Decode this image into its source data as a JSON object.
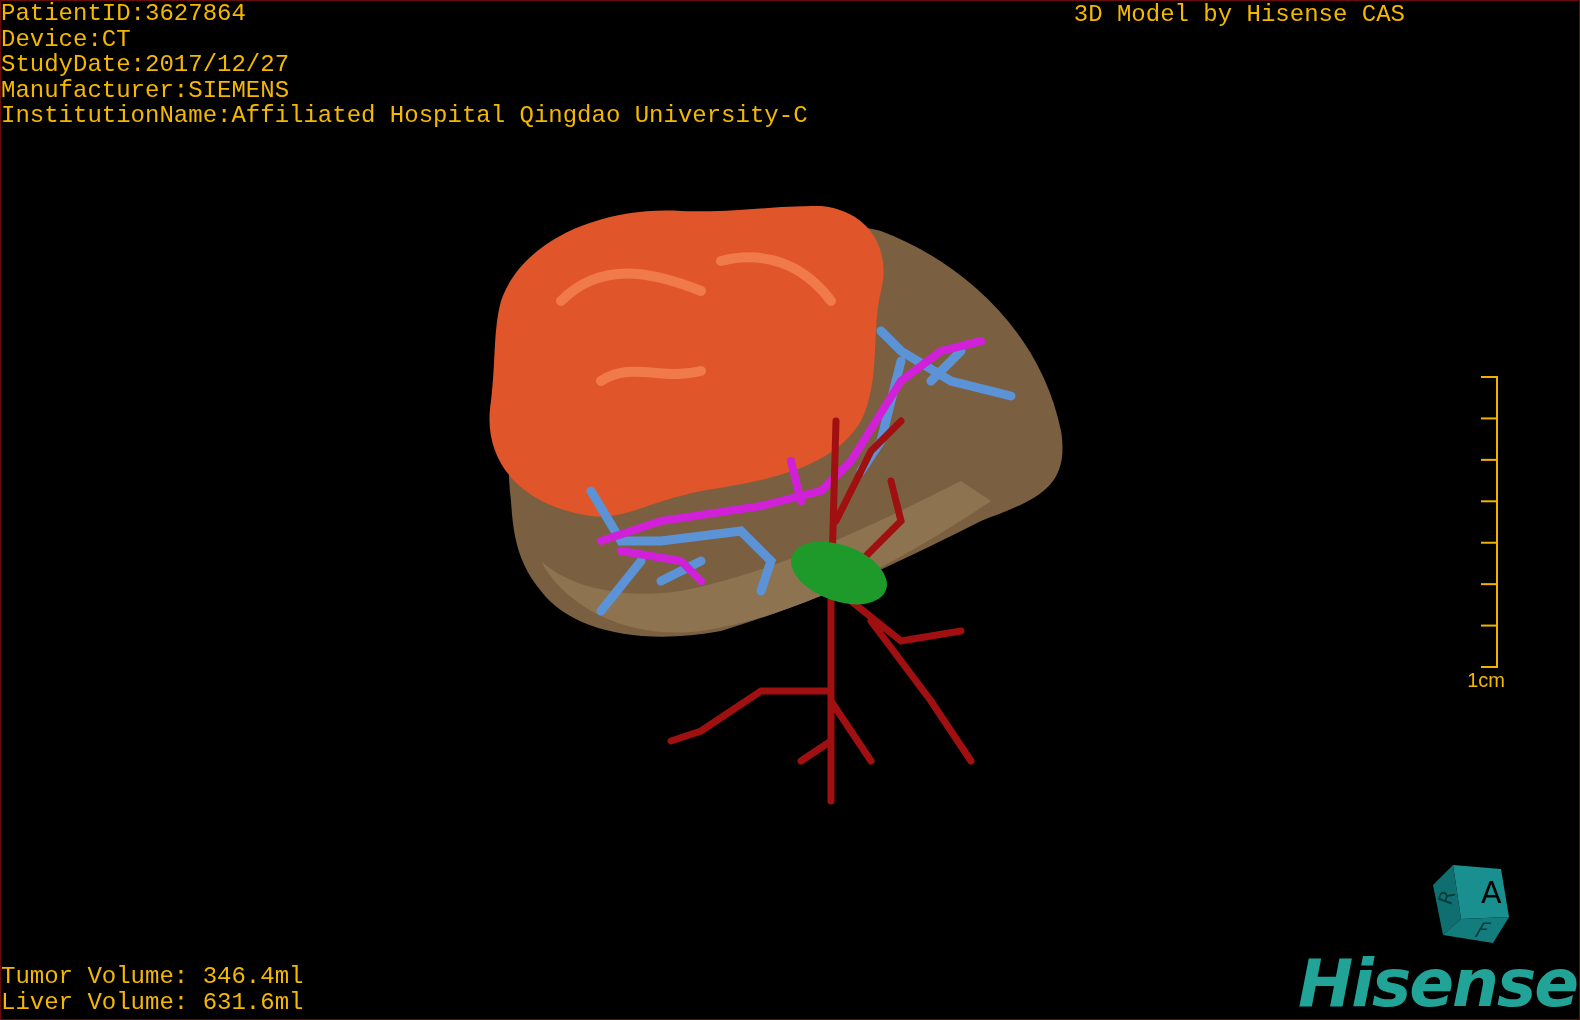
{
  "patient_info": [
    "PatientID:3627864",
    "Device:CT",
    "StudyDate:2017/12/27",
    "Manufacturer:SIEMENS",
    "InstitutionName:Affiliated Hospital Qingdao University-C"
  ],
  "title": "3D Model by Hisense CAS",
  "scale_bar": {
    "label": "1cm"
  },
  "volumes": [
    "Tumor Volume: 346.4ml",
    "Liver Volume: 631.6ml"
  ],
  "orientation_cube": {
    "front": "A",
    "side": "R",
    "bottom": "F"
  },
  "logo": "Hisense"
}
